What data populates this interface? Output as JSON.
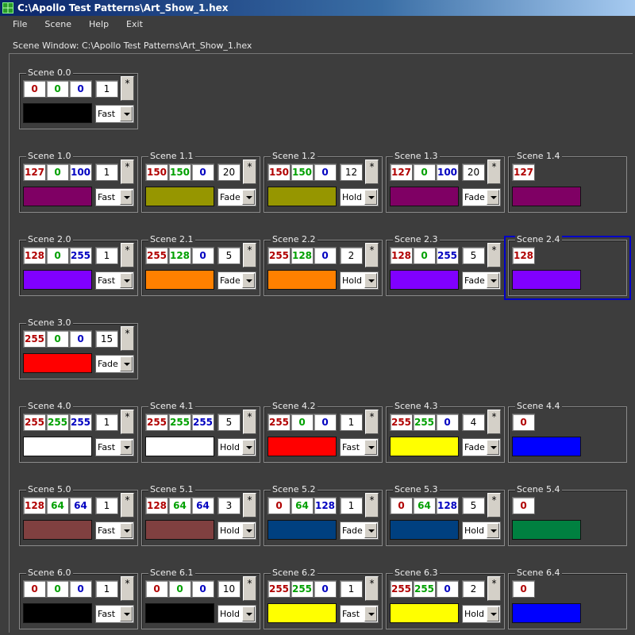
{
  "window": {
    "title": "C:\\Apollo Test Patterns\\Art_Show_1.hex"
  },
  "menu": [
    "File",
    "Scene",
    "Help",
    "Exit"
  ],
  "scene_window_label": "Scene Window:  C:\\Apollo Test Patterns\\Art_Show_1.hex",
  "star_label": "*",
  "scenes": [
    {
      "name": "Scene 0.0",
      "row": 0,
      "col": 0,
      "r": "0",
      "g": "0",
      "b": "0",
      "count": "1",
      "mode": "Fast",
      "color": "#000000"
    },
    {
      "name": "Scene 1.0",
      "row": 1,
      "col": 0,
      "r": "127",
      "g": "0",
      "b": "100",
      "count": "1",
      "mode": "Fast",
      "color": "#7f0064"
    },
    {
      "name": "Scene 1.1",
      "row": 1,
      "col": 1,
      "r": "150",
      "g": "150",
      "b": "0",
      "count": "20",
      "mode": "Fade",
      "color": "#969600"
    },
    {
      "name": "Scene 1.2",
      "row": 1,
      "col": 2,
      "r": "150",
      "g": "150",
      "b": "0",
      "count": "12",
      "mode": "Hold",
      "color": "#969600"
    },
    {
      "name": "Scene 1.3",
      "row": 1,
      "col": 3,
      "r": "127",
      "g": "0",
      "b": "100",
      "count": "20",
      "mode": "Fade",
      "color": "#7f0064"
    },
    {
      "name": "Scene 1.4",
      "row": 1,
      "col": 4,
      "r": "127",
      "color": "#7f0064"
    },
    {
      "name": "Scene 2.0",
      "row": 2,
      "col": 0,
      "r": "128",
      "g": "0",
      "b": "255",
      "count": "1",
      "mode": "Fast",
      "color": "#8000ff"
    },
    {
      "name": "Scene 2.1",
      "row": 2,
      "col": 1,
      "r": "255",
      "g": "128",
      "b": "0",
      "count": "5",
      "mode": "Fade",
      "color": "#ff8000"
    },
    {
      "name": "Scene 2.2",
      "row": 2,
      "col": 2,
      "r": "255",
      "g": "128",
      "b": "0",
      "count": "2",
      "mode": "Hold",
      "color": "#ff8000"
    },
    {
      "name": "Scene 2.3",
      "row": 2,
      "col": 3,
      "r": "128",
      "g": "0",
      "b": "255",
      "count": "5",
      "mode": "Fade",
      "color": "#8000ff"
    },
    {
      "name": "Scene 2.4",
      "row": 2,
      "col": 4,
      "r": "128",
      "color": "#8000ff",
      "focused": true
    },
    {
      "name": "Scene 3.0",
      "row": 3,
      "col": 0,
      "r": "255",
      "g": "0",
      "b": "0",
      "count": "15",
      "mode": "Fade",
      "color": "#ff0000"
    },
    {
      "name": "Scene 4.0",
      "row": 4,
      "col": 0,
      "r": "255",
      "g": "255",
      "b": "255",
      "count": "1",
      "mode": "Fast",
      "color": "#ffffff"
    },
    {
      "name": "Scene 4.1",
      "row": 4,
      "col": 1,
      "r": "255",
      "g": "255",
      "b": "255",
      "count": "5",
      "mode": "Hold",
      "color": "#ffffff"
    },
    {
      "name": "Scene 4.2",
      "row": 4,
      "col": 2,
      "r": "255",
      "g": "0",
      "b": "0",
      "count": "1",
      "mode": "Fast",
      "color": "#ff0000"
    },
    {
      "name": "Scene 4.3",
      "row": 4,
      "col": 3,
      "r": "255",
      "g": "255",
      "b": "0",
      "count": "4",
      "mode": "Fade",
      "color": "#ffff00"
    },
    {
      "name": "Scene 4.4",
      "row": 4,
      "col": 4,
      "r": "0",
      "color": "#0000ff"
    },
    {
      "name": "Scene 5.0",
      "row": 5,
      "col": 0,
      "r": "128",
      "g": "64",
      "b": "64",
      "count": "1",
      "mode": "Fast",
      "color": "#804040"
    },
    {
      "name": "Scene 5.1",
      "row": 5,
      "col": 1,
      "r": "128",
      "g": "64",
      "b": "64",
      "count": "3",
      "mode": "Hold",
      "color": "#804040"
    },
    {
      "name": "Scene 5.2",
      "row": 5,
      "col": 2,
      "r": "0",
      "g": "64",
      "b": "128",
      "count": "1",
      "mode": "Fade",
      "color": "#004080"
    },
    {
      "name": "Scene 5.3",
      "row": 5,
      "col": 3,
      "r": "0",
      "g": "64",
      "b": "128",
      "count": "5",
      "mode": "Hold",
      "color": "#004080"
    },
    {
      "name": "Scene 5.4",
      "row": 5,
      "col": 4,
      "r": "0",
      "color": "#008040"
    },
    {
      "name": "Scene 6.0",
      "row": 6,
      "col": 0,
      "r": "0",
      "g": "0",
      "b": "0",
      "count": "1",
      "mode": "Fast",
      "color": "#000000"
    },
    {
      "name": "Scene 6.1",
      "row": 6,
      "col": 1,
      "r": "0",
      "g": "0",
      "b": "0",
      "count": "10",
      "mode": "Hold",
      "color": "#000000"
    },
    {
      "name": "Scene 6.2",
      "row": 6,
      "col": 2,
      "r": "255",
      "g": "255",
      "b": "0",
      "count": "1",
      "mode": "Fast",
      "color": "#ffff00"
    },
    {
      "name": "Scene 6.3",
      "row": 6,
      "col": 3,
      "r": "255",
      "g": "255",
      "b": "0",
      "count": "2",
      "mode": "Hold",
      "color": "#ffff00"
    },
    {
      "name": "Scene 6.4",
      "row": 6,
      "col": 4,
      "r": "0",
      "color": "#0000ff"
    }
  ]
}
